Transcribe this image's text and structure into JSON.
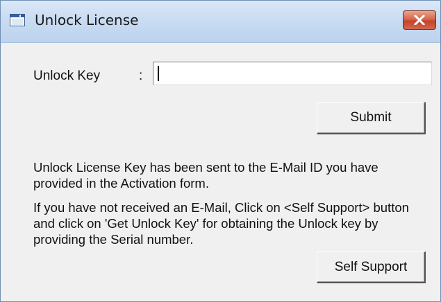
{
  "window": {
    "title": "Unlock License",
    "icons": {
      "app": "window-app-icon",
      "close": "close-icon"
    },
    "colors": {
      "title_bar": "#c9dcf2",
      "close_button": "#d2664c",
      "body": "#f0f0f0"
    }
  },
  "form": {
    "unlock_key_label": "Unlock Key",
    "colon": ":",
    "unlock_key_value": "",
    "submit_label": "Submit"
  },
  "info": {
    "paragraph_1": "Unlock License Key has been sent to the E-Mail ID you have provided in the Activation form.",
    "paragraph_2": "If you have not received an E-Mail, Click on <Self Support> button and click on 'Get Unlock Key' for obtaining the Unlock key by providing the Serial number."
  },
  "actions": {
    "self_support_label": "Self Support"
  }
}
